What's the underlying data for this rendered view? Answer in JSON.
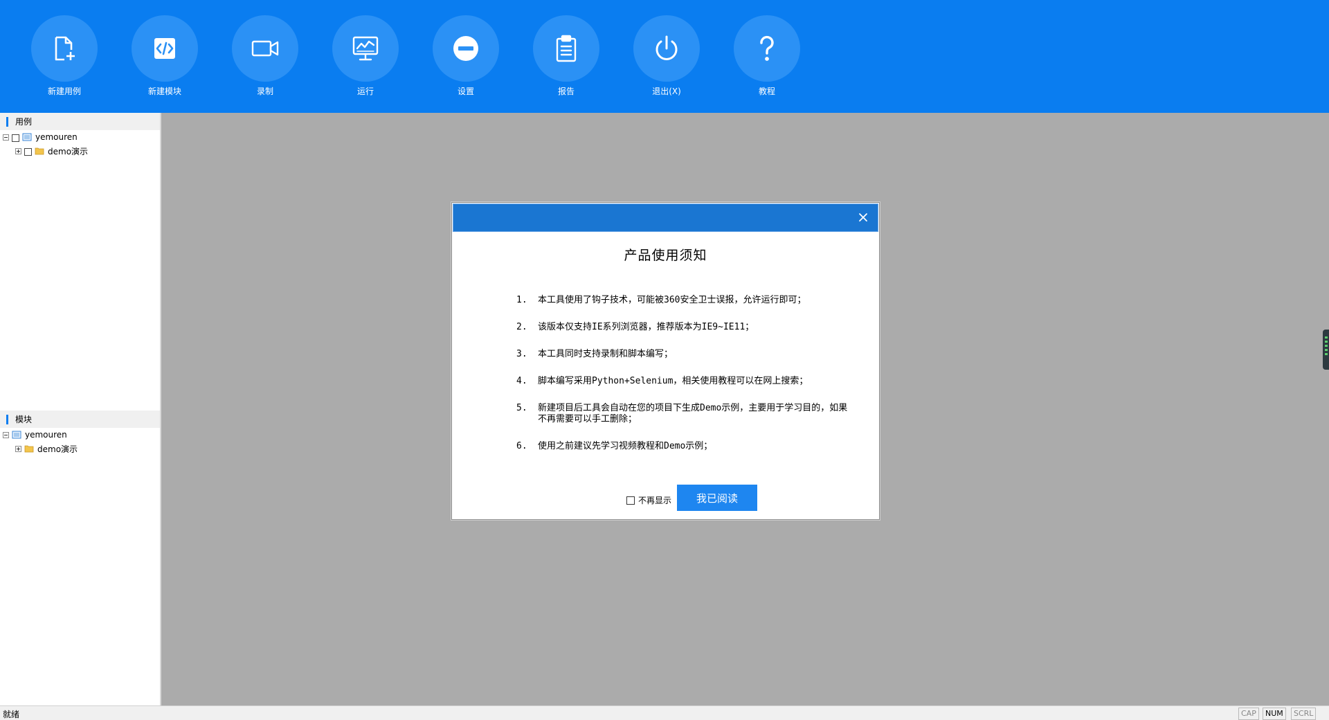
{
  "toolbar": {
    "buttons": [
      {
        "label": "新建用例",
        "icon": "new-file-icon"
      },
      {
        "label": "新建模块",
        "icon": "code-file-icon"
      },
      {
        "label": "录制",
        "icon": "video-camera-icon"
      },
      {
        "label": "运行",
        "icon": "monitor-chart-icon"
      },
      {
        "label": "设置",
        "icon": "minus-circle-icon"
      },
      {
        "label": "报告",
        "icon": "clipboard-icon"
      },
      {
        "label": "退出(X)",
        "icon": "power-icon"
      },
      {
        "label": "教程",
        "icon": "question-icon"
      }
    ]
  },
  "cases_panel": {
    "title": "用例",
    "root": "yemouren",
    "child": "demo演示"
  },
  "modules_panel": {
    "title": "模块",
    "root": "yemouren",
    "child": "demo演示"
  },
  "dialog": {
    "heading": "产品使用须知",
    "items": [
      {
        "num": "1.",
        "text": "本工具使用了钩子技术，可能被360安全卫士误报，允许运行即可；"
      },
      {
        "num": "2.",
        "text": "该版本仅支持IE系列浏览器，推荐版本为IE9~IE11；"
      },
      {
        "num": "3.",
        "text": "本工具同时支持录制和脚本编写；"
      },
      {
        "num": "4.",
        "text": "脚本编写采用Python+Selenium，相关使用教程可以在网上搜索；"
      },
      {
        "num": "5.",
        "text": "新建项目后工具会自动在您的项目下生成Demo示例，主要用于学习目的，如果不再需要可以手工删除；"
      },
      {
        "num": "6.",
        "text": "使用之前建议先学习视频教程和Demo示例；"
      }
    ],
    "dont_show_label": "不再显示",
    "read_button": "我已阅读"
  },
  "statusbar": {
    "text": "就绪",
    "indicators": {
      "cap": "CAP",
      "num": "NUM",
      "scrl": "SCRL"
    }
  },
  "colors": {
    "toolbar": "#0a7df0",
    "button_circle": "#2b91f5",
    "dialog_title": "#1a76d2",
    "primary_button": "#1e86f0"
  }
}
